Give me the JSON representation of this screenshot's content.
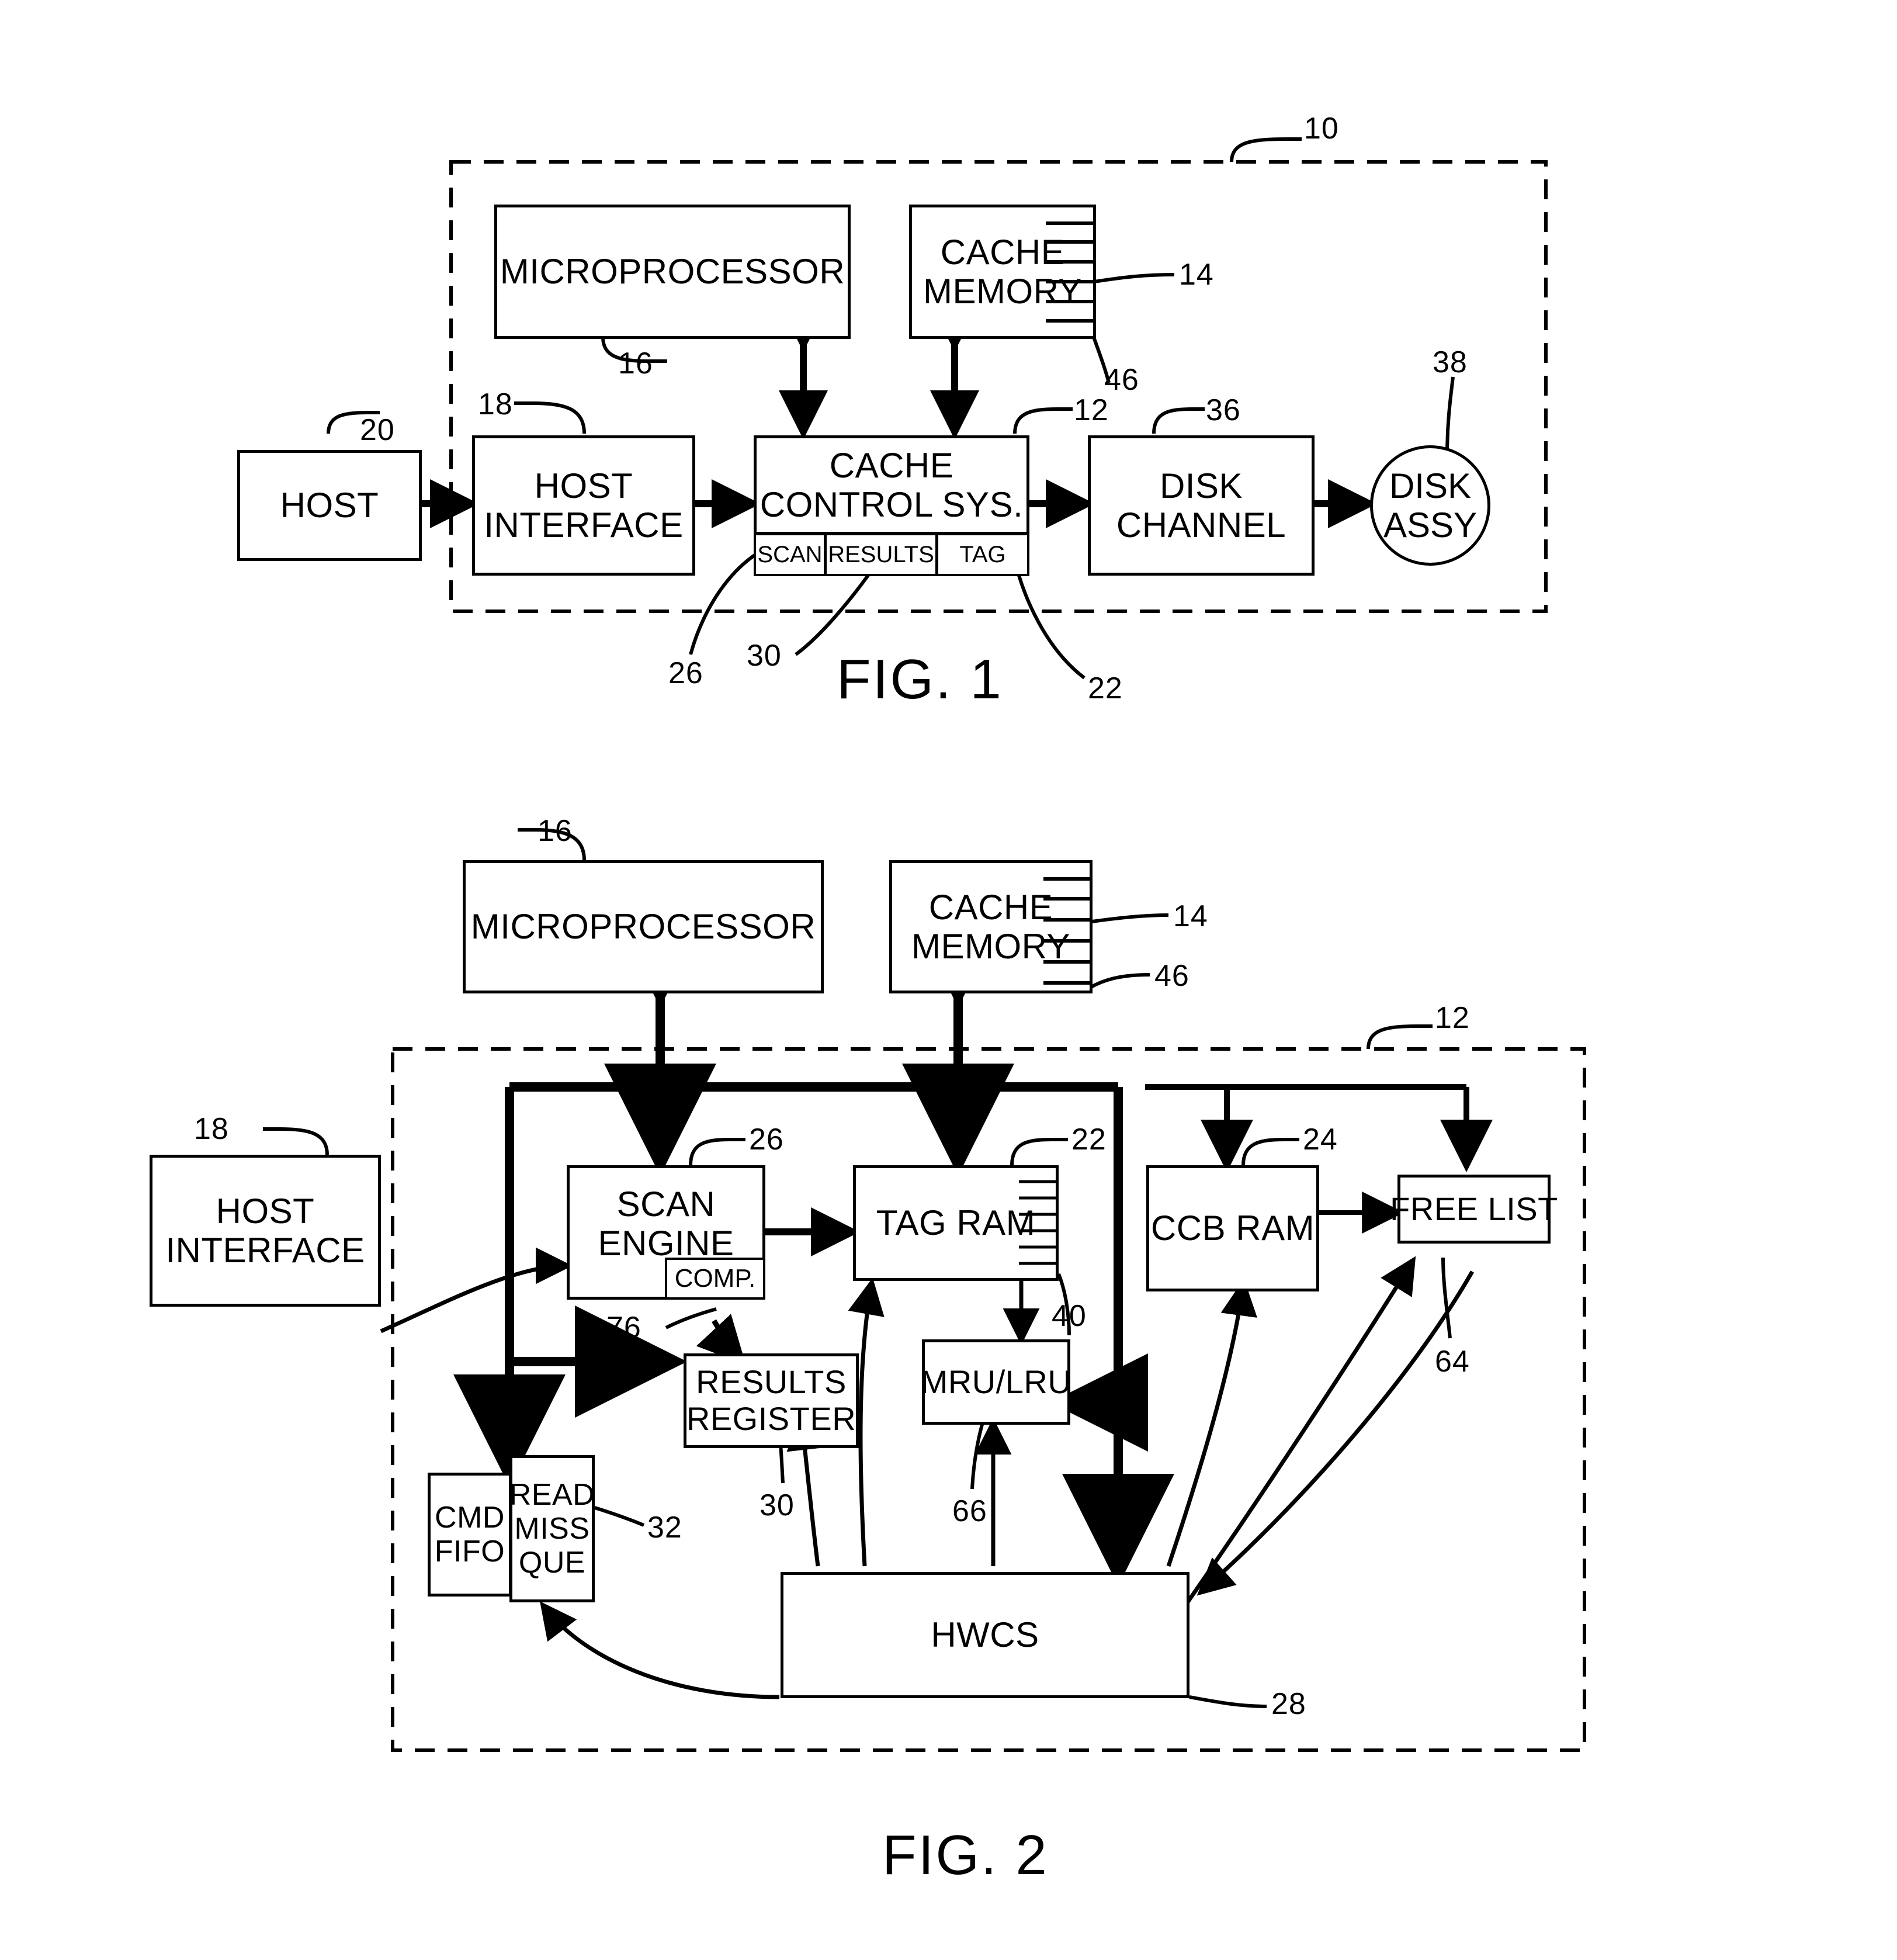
{
  "document": {
    "type": "patent-drawing-sheet",
    "figures": [
      "FIG. 1",
      "FIG. 2"
    ]
  },
  "fig1": {
    "caption": "FIG. 1",
    "system_ref": "10",
    "blocks": {
      "microprocessor": {
        "label": "MICROPROCESSOR",
        "ref": "16"
      },
      "cache_memory": {
        "label_line1": "CACHE",
        "label_line2": "MEMORY",
        "ref": "14",
        "segment_ref": "46"
      },
      "host": {
        "label": "HOST",
        "ref": "20"
      },
      "host_interface": {
        "label_line1": "HOST",
        "label_line2": "INTERFACE",
        "ref": "18"
      },
      "cache_control_sys": {
        "label_line1": "CACHE",
        "label_line2": "CONTROL SYS.",
        "ref": "12"
      },
      "scan": {
        "label": "SCAN",
        "ref": "26"
      },
      "results": {
        "label": "RESULTS",
        "ref": "30"
      },
      "tag": {
        "label": "TAG",
        "ref": "22"
      },
      "disk_channel": {
        "label_line1": "DISK",
        "label_line2": "CHANNEL",
        "ref": "36"
      },
      "disk_assy": {
        "label_line1": "DISK",
        "label_line2": "ASSY",
        "ref": "38"
      }
    }
  },
  "fig2": {
    "caption": "FIG. 2",
    "system_ref": "12",
    "blocks": {
      "microprocessor": {
        "label": "MICROPROCESSOR",
        "ref": "16"
      },
      "cache_memory": {
        "label_line1": "CACHE",
        "label_line2": "MEMORY",
        "ref": "14",
        "segment_ref": "46"
      },
      "host_interface": {
        "label_line1": "HOST",
        "label_line2": "INTERFACE",
        "ref": "18"
      },
      "scan_engine": {
        "label_line1": "SCAN",
        "label_line2": "ENGINE",
        "ref": "26"
      },
      "comp": {
        "label": "COMP.",
        "ref": "76"
      },
      "tag_ram": {
        "label": "TAG RAM",
        "ref": "22",
        "segment_ref": "40"
      },
      "ccb_ram": {
        "label": "CCB RAM",
        "ref": "24"
      },
      "free_list": {
        "label": "FREE LIST",
        "ref": "64"
      },
      "results_register": {
        "label_line1": "RESULTS",
        "label_line2": "REGISTER",
        "ref": "30"
      },
      "mru_lru": {
        "label": "MRU/LRU",
        "ref": "66"
      },
      "cmd_fifo": {
        "label_line1": "CMD",
        "label_line2": "FIFO"
      },
      "read_miss_que": {
        "label_line1": "READ",
        "label_line2": "MISS",
        "label_line3": "QUE",
        "ref": "32"
      },
      "hwcs": {
        "label": "HWCS",
        "ref": "28"
      }
    }
  },
  "colors": {
    "ink": "#000000",
    "paper": "#ffffff"
  }
}
